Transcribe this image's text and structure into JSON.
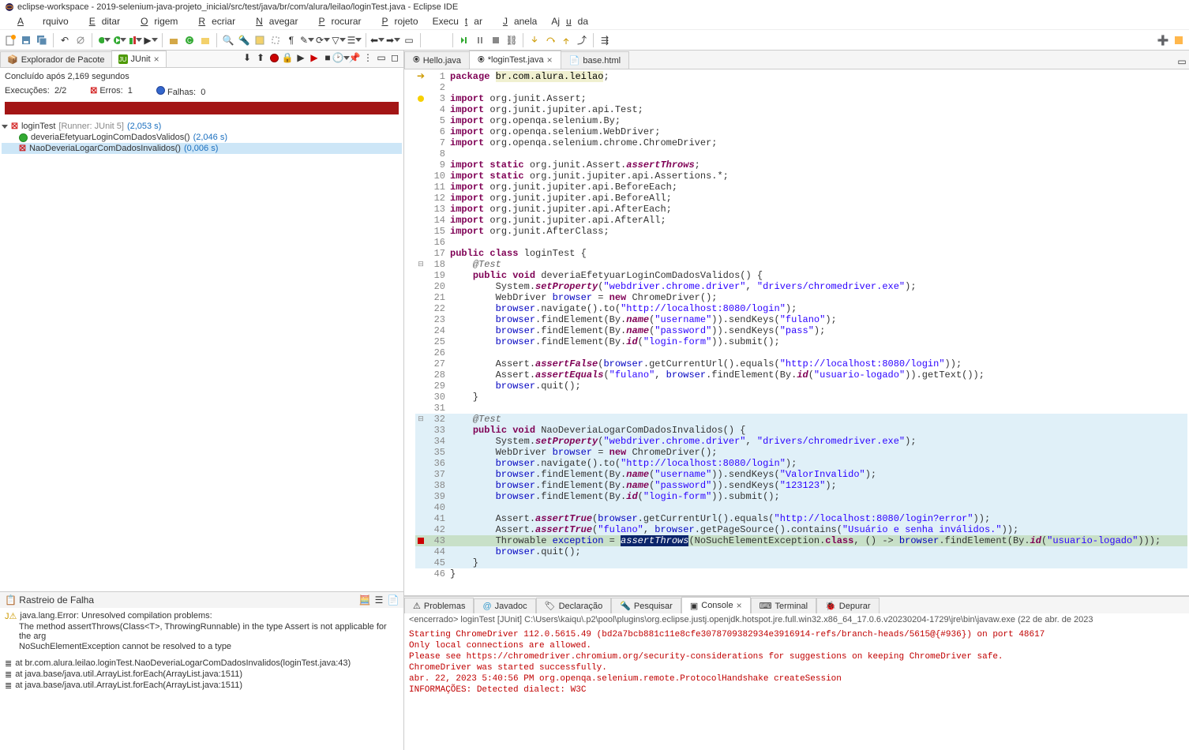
{
  "window": {
    "title": "eclipse-workspace - 2019-selenium-java-projeto_inicial/src/test/java/br/com/alura/leilao/loginTest.java - Eclipse IDE"
  },
  "menu": {
    "file": "Arquivo",
    "edit": "Editar",
    "source": "Origem",
    "refactor": "Recriar",
    "navigate": "Navegar",
    "search": "Procurar",
    "project": "Projeto",
    "run": "Executar",
    "window": "Janela",
    "help": "Ajuda"
  },
  "views": {
    "package_explorer": "Explorador de Pacote",
    "junit": "JUnit"
  },
  "junit": {
    "finished": "Concluído após 2,169 segundos",
    "runs_label": "Execuções:",
    "runs_value": "2/2",
    "errors_label": "Erros:",
    "errors_value": "1",
    "failures_label": "Falhas:",
    "failures_value": "0",
    "root": "loginTest",
    "runner": "[Runner: JUnit 5]",
    "root_time": "(2,053 s)",
    "test1": "deveriaEfetyuarLoginComDadosValidos()",
    "test1_time": "(2,046 s)",
    "test2": "NaoDeveriaLogarComDadosInvalidos()",
    "test2_time": "(0,006 s)"
  },
  "trace": {
    "title": "Rastreio de Falha",
    "err1": "java.lang.Error: Unresolved compilation problems:",
    "err2": "The method assertThrows(Class<T>, ThrowingRunnable) in the type Assert is not applicable for the arg",
    "err3": "NoSuchElementException cannot be resolved to a type",
    "at1": "at br.com.alura.leilao.loginTest.NaoDeveriaLogarComDadosInvalidos(loginTest.java:43)",
    "at2": "at java.base/java.util.ArrayList.forEach(ArrayList.java:1511)",
    "at3": "at java.base/java.util.ArrayList.forEach(ArrayList.java:1511)"
  },
  "editor": {
    "tab1": "Hello.java",
    "tab2": "*loginTest.java",
    "tab3": "base.html"
  },
  "bottom": {
    "problems": "Problemas",
    "javadoc": "Javadoc",
    "declaration": "Declaração",
    "search": "Pesquisar",
    "console": "Console",
    "terminal": "Terminal",
    "debug": "Depurar"
  },
  "console": {
    "header": "<encerrado> loginTest [JUnit] C:\\Users\\kaiqu\\.p2\\pool\\plugins\\org.eclipse.justj.openjdk.hotspot.jre.full.win32.x86_64_17.0.6.v20230204-1729\\jre\\bin\\javaw.exe  (22 de abr. de 2023",
    "l1": "Starting ChromeDriver 112.0.5615.49 (bd2a7bcb881c11e8cfe3078709382934e3916914-refs/branch-heads/5615@{#936}) on port 48617",
    "l2": "Only local connections are allowed.",
    "l3": "Please see https://chromedriver.chromium.org/security-considerations for suggestions on keeping ChromeDriver safe.",
    "l4": "ChromeDriver was started successfully.",
    "l5": "abr. 22, 2023 5:40:56 PM org.openqa.selenium.remote.ProtocolHandshake createSession",
    "l6": "INFORMAÇÕES: Detected dialect: W3C"
  },
  "code": {
    "pkg": "br.com.alura.leilao"
  }
}
